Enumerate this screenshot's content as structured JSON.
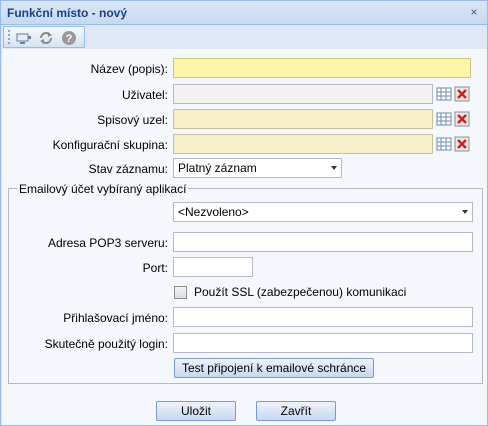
{
  "window": {
    "title": "Funkční místo - nový",
    "close_symbol": "×"
  },
  "toolbar": {
    "items": [
      {
        "icon": "grip-icon"
      },
      {
        "icon": "screen-icon"
      },
      {
        "icon": "refresh-icon"
      },
      {
        "icon": "help-icon"
      }
    ]
  },
  "form": {
    "nazev": {
      "label": "Název (popis):",
      "value": ""
    },
    "uzivatel": {
      "label": "Uživatel:",
      "value": ""
    },
    "spisovy_uzel": {
      "label": "Spisový uzel:",
      "value": ""
    },
    "konfiguracni_skupina": {
      "label": "Konfigurační skupina:",
      "value": ""
    },
    "stav_zaznamu": {
      "label": "Stav záznamu:",
      "value": "Platný záznam"
    }
  },
  "email": {
    "legend": "Emailový účet vybíraný aplikací",
    "account_select": "<Nezvoleno>",
    "pop3": {
      "label": "Adresa POP3 serveru:",
      "value": ""
    },
    "port": {
      "label": "Port:",
      "value": ""
    },
    "ssl": {
      "label": "Použít SSL (zabezpečenou) komunikaci",
      "checked": false
    },
    "login_name": {
      "label": "Přihlašovací jméno:",
      "value": ""
    },
    "real_login": {
      "label": "Skutečně použitý login:",
      "value": ""
    },
    "test_button": "Test připojení k emailové schránce"
  },
  "buttons": {
    "save": "Uložit",
    "close": "Zavřít"
  },
  "colors": {
    "required": "#fff5a8",
    "readonly": "#f6edc9",
    "title": "#15428b",
    "clear_red": "#cc2222"
  }
}
